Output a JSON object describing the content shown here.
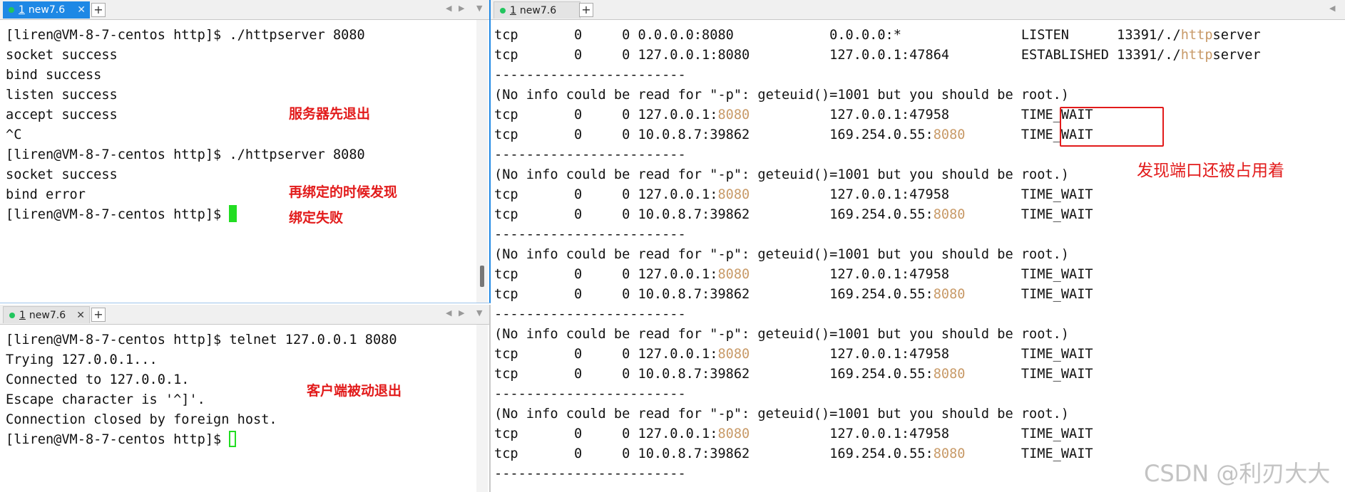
{
  "left_top": {
    "tab": {
      "num": "1",
      "title": "new7.6",
      "close": "✕"
    },
    "lines": [
      "[liren@VM-8-7-centos http]$ ./httpserver 8080",
      "socket success",
      "bind success",
      "listen success",
      "accept success",
      "^C",
      "[liren@VM-8-7-centos http]$ ./httpserver 8080",
      "socket success",
      "bind error",
      "[liren@VM-8-7-centos http]$ "
    ]
  },
  "left_bottom": {
    "tab": {
      "num": "1",
      "title": "new7.6",
      "close": "✕"
    },
    "lines": [
      "[liren@VM-8-7-centos http]$ telnet 127.0.0.1 8080",
      "Trying 127.0.0.1...",
      "Connected to 127.0.0.1.",
      "Escape character is '^]'.",
      "Connection closed by foreign host.",
      "[liren@VM-8-7-centos http]$ "
    ]
  },
  "right": {
    "tab": {
      "num": "1",
      "title": "new7.6"
    },
    "header_lines": [
      {
        "proto": "tcp",
        "recvq": "0",
        "sendq": "0",
        "local": "0.0.0.0:8080",
        "foreign": "0.0.0.0:*",
        "state": "LISTEN",
        "pid_pre": "13391/./",
        "pid_hl": "http",
        "pid_post": "server"
      },
      {
        "proto": "tcp",
        "recvq": "0",
        "sendq": "0",
        "local": "127.0.0.1:8080",
        "foreign": "127.0.0.1:47864",
        "state": "ESTABLISHED",
        "pid_pre": "13391/./",
        "pid_hl": "http",
        "pid_post": "server"
      }
    ],
    "separator": "------------------------",
    "info": "(No info could be read for \"-p\": geteuid()=1001 but you should be root.)",
    "rows": [
      {
        "proto": "tcp",
        "recvq": "0",
        "sendq": "0",
        "local_ip": "127.0.0.1:",
        "local_port": "8080",
        "foreign_ip": "127.0.0.1:47958",
        "foreign_port": "",
        "state": "TIME_WAIT"
      },
      {
        "proto": "tcp",
        "recvq": "0",
        "sendq": "0",
        "local_ip": "10.0.8.7:39862",
        "local_port": "",
        "foreign_ip": "169.254.0.55:",
        "foreign_port": "8080",
        "state": "TIME_WAIT"
      }
    ],
    "blocks": 5
  },
  "annotations": {
    "server_exit": "服务器先退出",
    "rebind_1": "再绑定的时候发现",
    "rebind_2": "绑定失败",
    "client_exit": "客户端被动退出",
    "port_occupied": "发现端口还被占用着"
  },
  "watermark": "CSDN @利刃大大",
  "colors": {
    "tab_active": "#1e88e5",
    "annotation": "#e21b1b",
    "port_highlight": "#c89a68",
    "cursor": "#22dd22"
  }
}
